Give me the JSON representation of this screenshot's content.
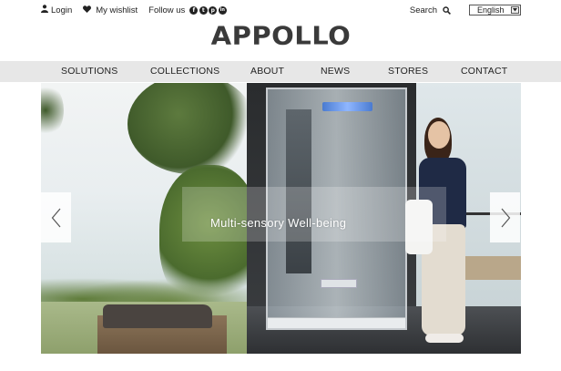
{
  "topbar": {
    "login_label": "Login",
    "wishlist_label": "My wishlist",
    "follow_label": "Follow us",
    "social": [
      {
        "icon": "facebook-icon",
        "glyph": "f"
      },
      {
        "icon": "twitter-icon",
        "glyph": "t"
      },
      {
        "icon": "pinterest-icon",
        "glyph": "p"
      },
      {
        "icon": "linkedin-icon",
        "glyph": "in"
      }
    ],
    "search_label": "Search",
    "language_selected": "English"
  },
  "brand": {
    "logo_text": "APPOLLO"
  },
  "nav": {
    "items": [
      {
        "label": "SOLUTIONS"
      },
      {
        "label": "COLLECTIONS"
      },
      {
        "label": "ABOUT"
      },
      {
        "label": "NEWS"
      },
      {
        "label": "STORES"
      },
      {
        "label": "CONTACT"
      }
    ]
  },
  "hero": {
    "caption": "Multi-sensory Well-being",
    "prev_icon": "chevron-left-icon",
    "next_icon": "chevron-right-icon"
  }
}
